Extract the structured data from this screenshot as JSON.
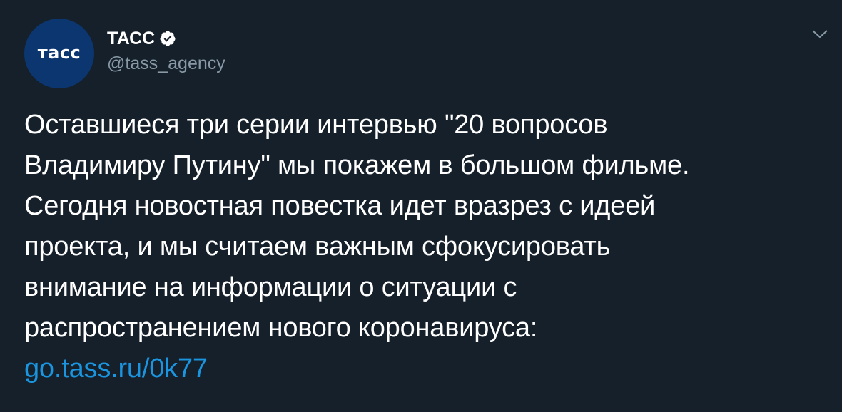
{
  "author": {
    "avatar_text": "тасс",
    "display_name": "ТАСС",
    "handle": "@tass_agency",
    "verified": true
  },
  "tweet": {
    "text": "Оставшиеся три серии интервью \"20 вопросов\nВладимиру Путину\" мы покажем в большом фильме.\nСегодня новостная повестка идет вразрез с идеей\nпроекта, и мы считаем важным сфокусировать\nвнимание на информации о ситуации с\nраспространением нового коронавируса:",
    "link": "go.tass.ru/0k77"
  },
  "icons": {
    "verified": "verified-badge-icon",
    "menu": "chevron-down-icon"
  },
  "colors": {
    "background": "#15202b",
    "link": "#1b95e0",
    "secondary_text": "#8899a6",
    "avatar_bg": "#0c3670"
  }
}
